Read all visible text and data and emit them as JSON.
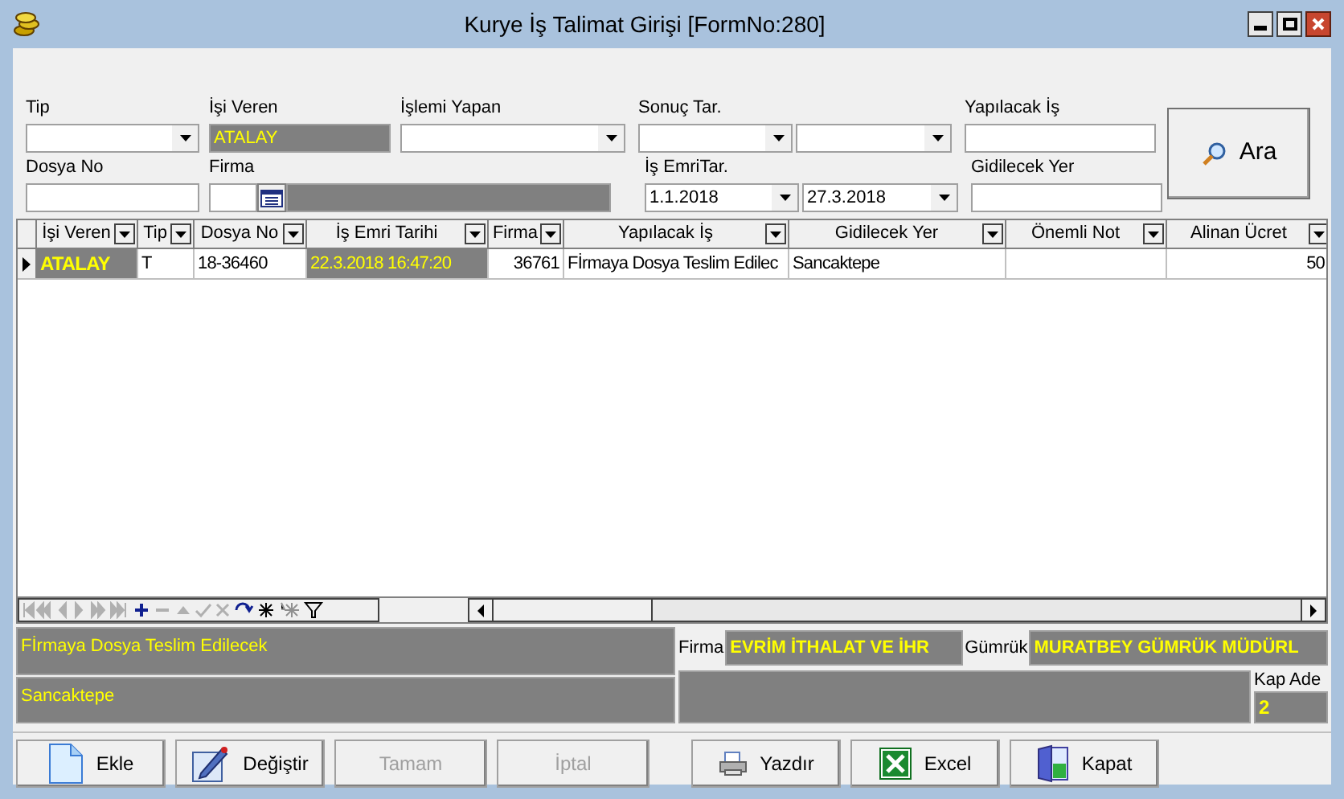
{
  "window": {
    "title": "Kurye İş Talimat Girişi [FormNo:280]"
  },
  "filters": {
    "tip": {
      "label": "Tip"
    },
    "isi_veren": {
      "label": "İşi Veren",
      "value": "ATALAY"
    },
    "islemi_yapan": {
      "label": "İşlemi Yapan"
    },
    "sonuc_tar": {
      "label": "Sonuç Tar."
    },
    "yapilacak_is": {
      "label": "Yapılacak İş"
    },
    "dosya_no": {
      "label": "Dosya No"
    },
    "firma": {
      "label": "Firma"
    },
    "is_emri_tar": {
      "label": "İş EmriTar.",
      "from": "1.1.2018",
      "to": "27.3.2018"
    },
    "gidilecek_yer": {
      "label": "Gidilecek Yer"
    }
  },
  "search_button": {
    "label": "Ara"
  },
  "table": {
    "columns": [
      {
        "label": "İşi Veren",
        "highlight": true
      },
      {
        "label": "Tip",
        "highlight": false
      },
      {
        "label": "Dosya No",
        "highlight": false
      },
      {
        "label": "İş Emri Tarihi",
        "highlight": true
      },
      {
        "label": "Firma",
        "highlight": false
      },
      {
        "label": "Yapılacak İş",
        "highlight": false
      },
      {
        "label": "Gidilecek Yer",
        "highlight": false
      },
      {
        "label": "Önemli Not",
        "highlight": false
      },
      {
        "label": "Alinan Ücret",
        "highlight": false
      }
    ],
    "rows": [
      {
        "selected": true,
        "cells": [
          "ATALAY",
          "T",
          "18-36460",
          "22.3.2018 16:47:20",
          "36761",
          "Fİrmaya Dosya Teslim Edilec",
          "Sancaktepe",
          null,
          "50"
        ]
      }
    ]
  },
  "details": {
    "yapilacak_is": "Fİrmaya Dosya Teslim Edilecek",
    "gidilecek_yer": "Sancaktepe",
    "firma_label": "Firma",
    "firma": "EVRİM İTHALAT VE İHR",
    "gumruk_label": "Gümrük",
    "gumruk": "MURATBEY GÜMRÜK MÜDÜRL",
    "kap_label": "Kap Ade",
    "kap": "2"
  },
  "buttons": [
    {
      "kind": "add",
      "label": "Ekle",
      "disabled": false
    },
    {
      "kind": "edit",
      "label": "Değiştir",
      "disabled": false
    },
    {
      "kind": "ok",
      "label": "Tamam",
      "disabled": true
    },
    {
      "kind": "cancel",
      "label": "İptal",
      "disabled": true
    },
    {
      "kind": "print",
      "label": "Yazdır",
      "disabled": false
    },
    {
      "kind": "excel",
      "label": "Excel",
      "disabled": false
    },
    {
      "kind": "close",
      "label": "Kapat",
      "disabled": false
    }
  ]
}
